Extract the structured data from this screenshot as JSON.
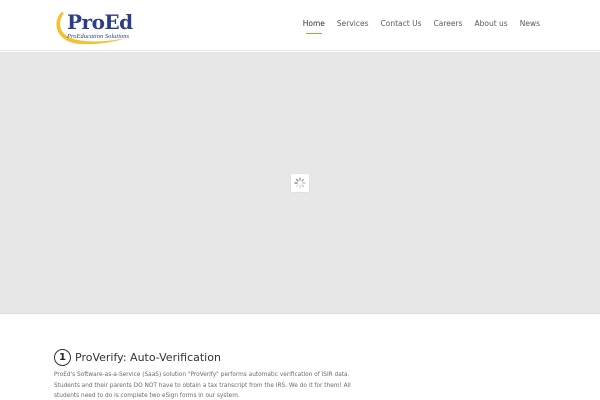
{
  "header": {
    "logo": {
      "title": "ProEd",
      "subtitle": "ProEducation Solutions",
      "swoosh_color": "#f2c230",
      "text_color": "#2b3f86"
    },
    "nav": [
      {
        "label": "Home",
        "active": true
      },
      {
        "label": "Services",
        "active": false
      },
      {
        "label": "Contact Us",
        "active": false
      },
      {
        "label": "Careers",
        "active": false
      },
      {
        "label": "About us",
        "active": false
      },
      {
        "label": "News",
        "active": false
      }
    ],
    "active_underline_color": "#7fbf3f"
  },
  "hero": {
    "background_color": "#e7e7e7",
    "loading_icon": "spinner-icon"
  },
  "content": {
    "step_number": "1",
    "title": "ProVerify: Auto-Verification",
    "paragraph": "ProEd's Software-as-a-Service (SaaS) solution \"ProVerify\" performs automatic verification of ISIR data. Students and their parents DO NOT have to obtain a tax transcript from the IRS. We do it for them! All students need to do is complete two eSign forms in our system."
  }
}
